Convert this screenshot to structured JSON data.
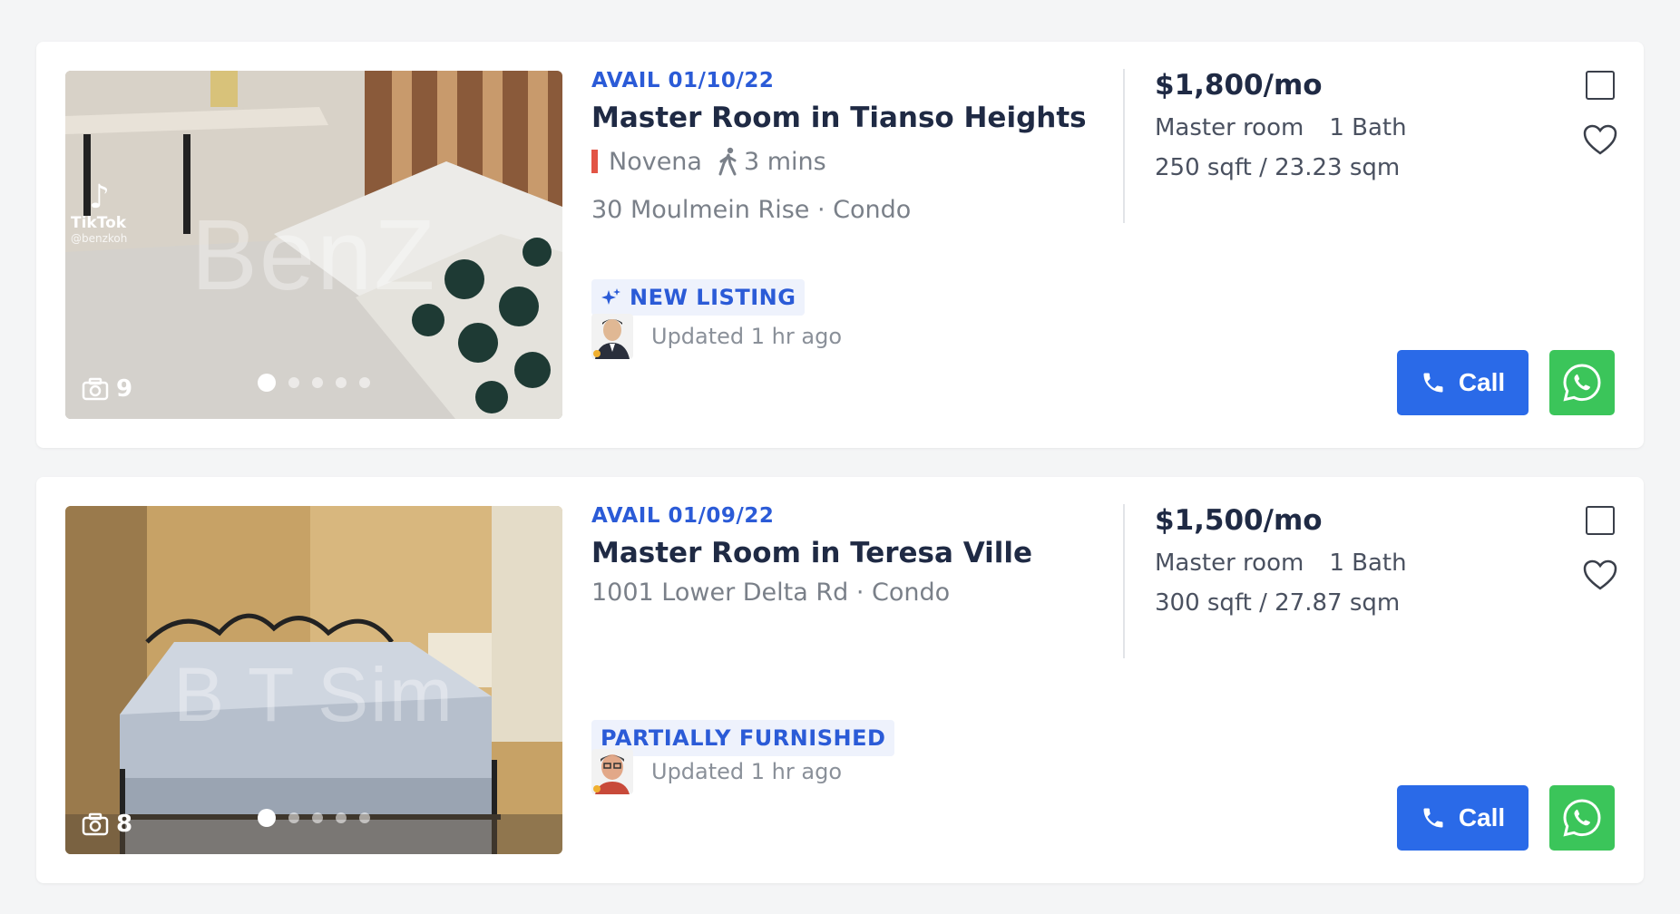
{
  "listings": [
    {
      "avail": "AVAIL 01/10/22",
      "title": "Master Room in Tianso Heights",
      "mrt": "Novena",
      "walk": "3 mins",
      "address": "30 Moulmein Rise · Condo",
      "tag": "NEW LISTING",
      "updated": "Updated 1 hr ago",
      "price": "$1,800/mo",
      "room_type": "Master room",
      "bath": "1 Bath",
      "size": "250 sqft / 23.23 sqm",
      "photo_count": "9",
      "watermark": "BenZ",
      "tiktok_name": "TikTok",
      "tiktok_handle": "@benzkoh",
      "call_label": "Call",
      "icons": {
        "camera": "camera-icon",
        "walk": "walking-person-icon",
        "sparkle": "sparkle-icon",
        "phone": "phone-icon",
        "whatsapp": "whatsapp-icon",
        "heart": "heart-icon"
      }
    },
    {
      "avail": "AVAIL 01/09/22",
      "title": "Master Room in Teresa Ville",
      "address": "1001 Lower Delta Rd · Condo",
      "tag": "PARTIALLY FURNISHED",
      "updated": "Updated 1 hr ago",
      "price": "$1,500/mo",
      "room_type": "Master room",
      "bath": "1 Bath",
      "size": "300 sqft / 27.87 sqm",
      "photo_count": "8",
      "watermark": "B T Sim",
      "call_label": "Call"
    }
  ],
  "colors": {
    "accent": "#2b5bd7",
    "call_button": "#2a6ae8",
    "whatsapp_button": "#3bc55a",
    "mrt_line": "#e25445"
  }
}
